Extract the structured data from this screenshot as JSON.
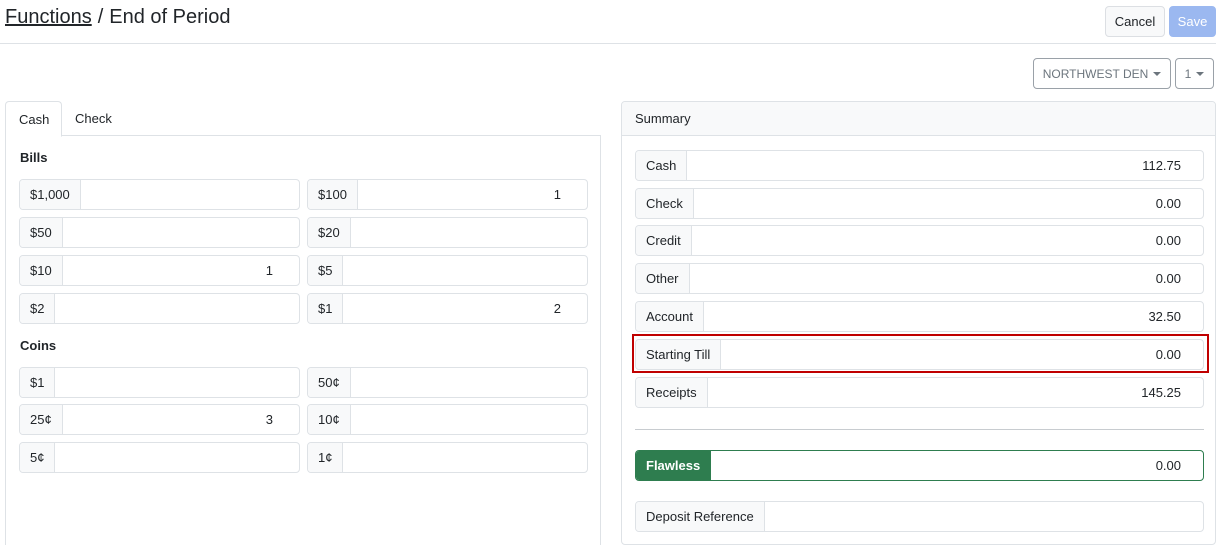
{
  "header": {
    "breadcrumb_parent": "Functions",
    "breadcrumb_separator": "/",
    "page_title": "End of Period",
    "cancel_label": "Cancel",
    "save_label": "Save"
  },
  "filters": {
    "location": "NORTHWEST DEN",
    "number": "1"
  },
  "tabs": {
    "cash": "Cash",
    "check": "Check"
  },
  "bills": {
    "title": "Bills",
    "items": [
      {
        "label": "$1,000",
        "value": ""
      },
      {
        "label": "$100",
        "value": "1"
      },
      {
        "label": "$50",
        "value": ""
      },
      {
        "label": "$20",
        "value": ""
      },
      {
        "label": "$10",
        "value": "1"
      },
      {
        "label": "$5",
        "value": ""
      },
      {
        "label": "$2",
        "value": ""
      },
      {
        "label": "$1",
        "value": "2"
      }
    ]
  },
  "coins": {
    "title": "Coins",
    "items": [
      {
        "label": "$1",
        "value": ""
      },
      {
        "label": "50¢",
        "value": ""
      },
      {
        "label": "25¢",
        "value": "3"
      },
      {
        "label": "10¢",
        "value": ""
      },
      {
        "label": "5¢",
        "value": ""
      },
      {
        "label": "1¢",
        "value": ""
      }
    ]
  },
  "summary": {
    "title": "Summary",
    "rows": [
      {
        "label": "Cash",
        "value": "112.75"
      },
      {
        "label": "Check",
        "value": "0.00"
      },
      {
        "label": "Credit",
        "value": "0.00"
      },
      {
        "label": "Other",
        "value": "0.00"
      },
      {
        "label": "Account",
        "value": "32.50"
      },
      {
        "label": "Starting Till",
        "value": "0.00"
      },
      {
        "label": "Receipts",
        "value": "145.25"
      }
    ],
    "flawless": {
      "label": "Flawless",
      "value": "0.00"
    },
    "deposit_reference": {
      "label": "Deposit Reference",
      "value": ""
    }
  },
  "colors": {
    "save_button": "#9bb8f0",
    "flawless_green": "#2e7d4f",
    "highlight_red": "#c00000"
  }
}
